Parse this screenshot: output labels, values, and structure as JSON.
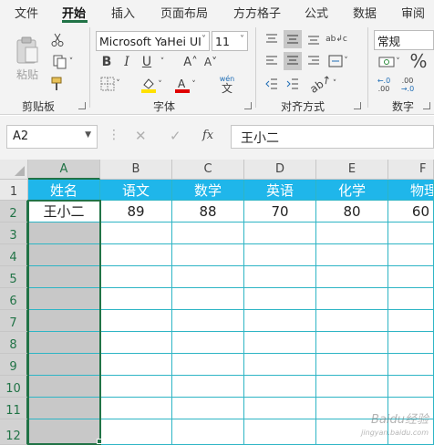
{
  "tabs": [
    "文件",
    "开始",
    "插入",
    "页面布局",
    "方方格子",
    "公式",
    "数据",
    "审阅"
  ],
  "active_tab": "开始",
  "ribbon": {
    "clipboard": {
      "paste_label": "粘贴",
      "group_label": "剪贴板"
    },
    "font": {
      "font_name": "Microsoft YaHei UI",
      "font_size": "11",
      "group_label": "字体",
      "bold": "B",
      "italic": "I",
      "underline": "U",
      "grow": "A˄",
      "shrink": "A˅",
      "phonetic_top": "wén",
      "phonetic_bottom": "文"
    },
    "alignment": {
      "group_label": "对齐方式",
      "wrap_text": "ab↲c"
    },
    "number": {
      "format": "常规",
      "group_label": "数字",
      "percent": "%",
      "inc_decimal_top": "←.0",
      "inc_decimal_bottom": ".00",
      "dec_decimal_top": ".00",
      "dec_decimal_bottom": "→.0"
    }
  },
  "formula_bar": {
    "name_box": "A2",
    "fx": "fx",
    "content": "王小二"
  },
  "columns": [
    "A",
    "B",
    "C",
    "D",
    "E",
    "F"
  ],
  "rows": [
    "1",
    "2",
    "3",
    "4",
    "5",
    "6",
    "7",
    "8",
    "9",
    "10",
    "11",
    "12"
  ],
  "table": {
    "headers": [
      "姓名",
      "语文",
      "数学",
      "英语",
      "化学",
      "物理"
    ],
    "row2": [
      "王小二",
      "89",
      "88",
      "70",
      "80",
      "60"
    ]
  },
  "colors": {
    "header_fill": "#1fb6ea",
    "selection": "#217346",
    "gridline": "#2eb5c5",
    "gray_fill": "#c8c8c8"
  },
  "watermark": {
    "brand": "Baidu经验",
    "url": "jingyan.baidu.com"
  }
}
